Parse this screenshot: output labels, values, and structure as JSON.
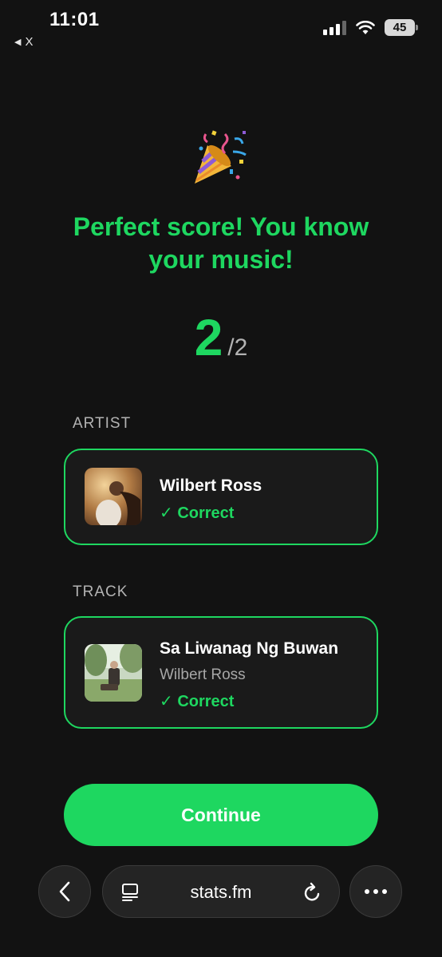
{
  "status_bar": {
    "time": "11:01",
    "back_app_label": "X",
    "battery": "45",
    "icons": [
      "signal-icon",
      "wifi-icon",
      "battery-icon"
    ]
  },
  "result": {
    "headline": "Perfect score! You know your music!",
    "score": "2",
    "total": "/2",
    "icon": "party-popper-icon"
  },
  "artist_section": {
    "label": "ARTIST",
    "name": "Wilbert Ross",
    "status": "✓ Correct"
  },
  "track_section": {
    "label": "TRACK",
    "title": "Sa Liwanag Ng Buwan",
    "artist": "Wilbert Ross",
    "status": "✓ Correct"
  },
  "continue_label": "Continue",
  "browser": {
    "url": "stats.fm",
    "icons": [
      "back-icon",
      "tabs-icon",
      "reload-icon",
      "more-icon"
    ]
  },
  "colors": {
    "accent": "#1ed760",
    "background": "#121212",
    "card": "#1a1a1a"
  }
}
